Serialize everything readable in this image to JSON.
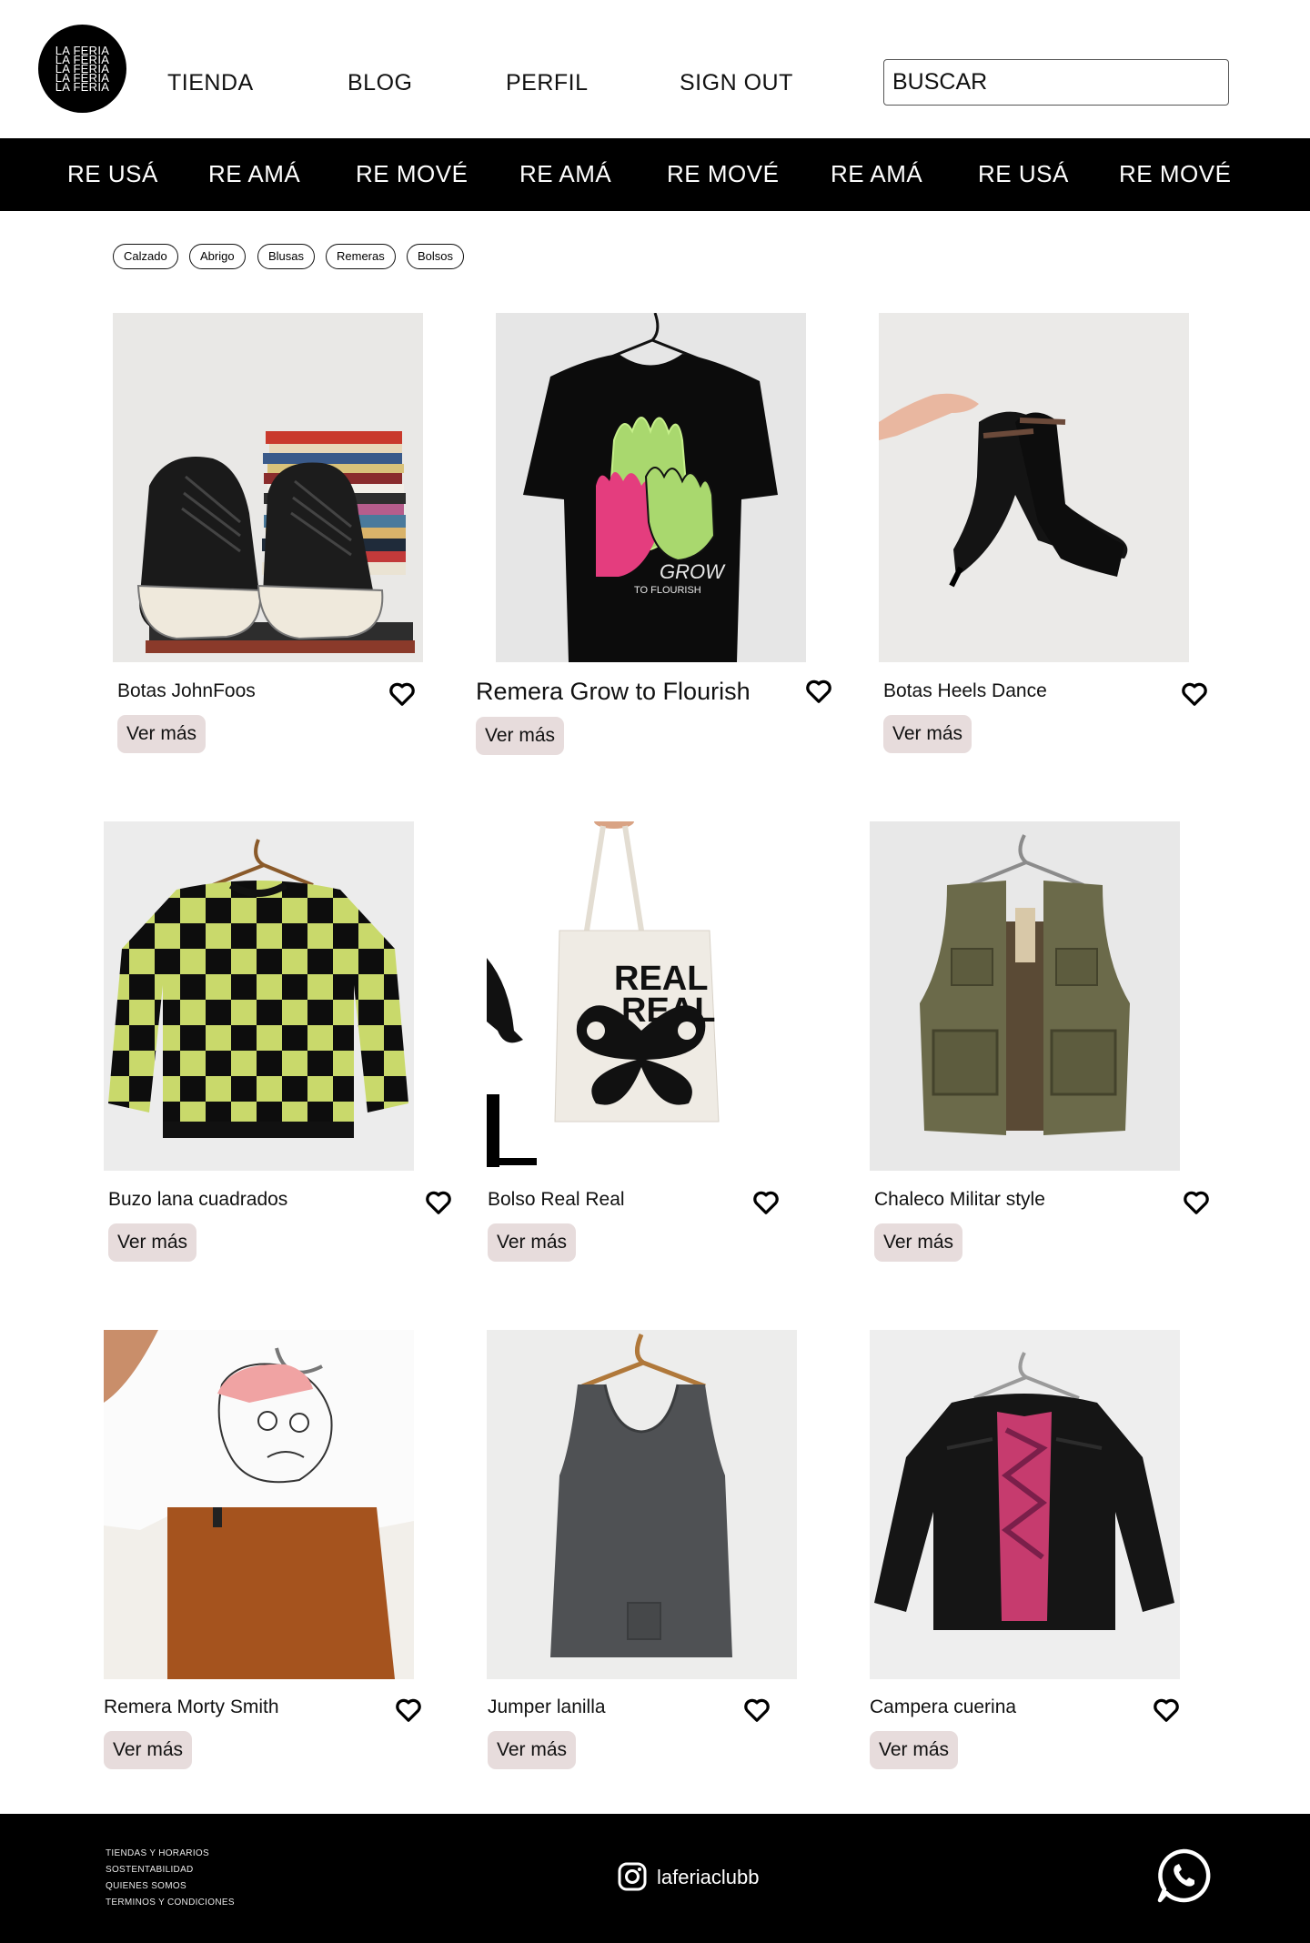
{
  "brand": {
    "logo_lines": [
      "LA FERIA",
      "LA FERIA",
      "LA FERIA",
      "LA FERIA",
      "LA FERIA"
    ]
  },
  "nav": {
    "tienda": "TIENDA",
    "blog": "BLOG",
    "perfil": "PERFIL",
    "signout": "SIGN OUT"
  },
  "search": {
    "placeholder": "BUSCAR"
  },
  "band": [
    "RE USÁ",
    "RE AMÁ",
    "RE MOVÉ",
    "RE AMÁ",
    "RE MOVÉ",
    "RE AMÁ",
    "RE USÁ",
    "RE MOVÉ"
  ],
  "filters": [
    "Calzado",
    "Abrigo",
    "Blusas",
    "Remeras",
    "Bolsos"
  ],
  "products": [
    {
      "name": "Botas JohnFoos",
      "cta": "Ver más"
    },
    {
      "name": "Remera Grow to Flourish",
      "cta": "Ver más"
    },
    {
      "name": "Botas Heels Dance",
      "cta": "Ver más"
    },
    {
      "name": "Buzo lana cuadrados",
      "cta": "Ver más"
    },
    {
      "name": "Bolso Real Real",
      "cta": "Ver más"
    },
    {
      "name": "Chaleco Militar style",
      "cta": "Ver más"
    },
    {
      "name": "Remera Morty Smith",
      "cta": "Ver más"
    },
    {
      "name": "Jumper lanilla",
      "cta": "Ver más"
    },
    {
      "name": "Campera cuerina",
      "cta": "Ver más"
    }
  ],
  "artwork": {
    "tshirt_text_1": "GROW",
    "tshirt_text_2": "TO FLOURISH",
    "bag_text_1": "REAL",
    "bag_text_2": "REAL"
  },
  "footer": {
    "links": [
      "TIENDAS Y HORARIOS",
      "SOSTENTABILIDAD",
      "QUIENES SOMOS",
      "TERMINOS Y CONDICIONES"
    ],
    "instagram": "laferiaclubb"
  },
  "colors": {
    "band_bg": "#000000",
    "button_bg": "#e7dcdc",
    "footer_bg": "#000000"
  },
  "icons": {
    "favorite": "heart-outline-icon",
    "instagram": "instagram-icon",
    "whatsapp": "whatsapp-icon"
  }
}
